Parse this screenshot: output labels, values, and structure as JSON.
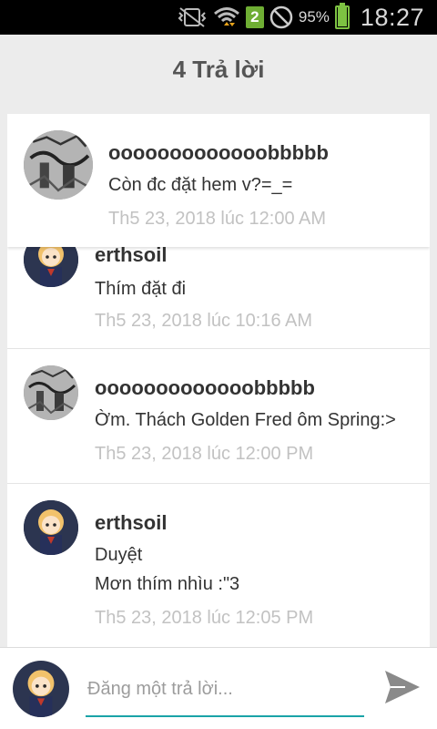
{
  "status_bar": {
    "sim_badge": "2",
    "battery_pct": "95%",
    "battery_level": 0.95,
    "time": "18:27",
    "icons": [
      "vibrate-off-icon",
      "wifi-icon",
      "sim-badge",
      "do-not-disturb-icon",
      "battery-icon"
    ]
  },
  "header": {
    "title": "4 Trả lời"
  },
  "original_post": {
    "author": "ooooooooooooobbbbb",
    "text": "Còn đc đặt hem v?=_=",
    "timestamp": "Th5 23, 2018 lúc 12:00 AM",
    "avatar": "sketch-avatar"
  },
  "replies": [
    {
      "author": "erthsoil",
      "text": "Thím đặt đi",
      "timestamp": "Th5 23, 2018 lúc 10:16 AM",
      "avatar": "anime-girl-avatar"
    },
    {
      "author": "ooooooooooooobbbbb",
      "text": "Ờm. Thách Golden Fred ôm Spring:>",
      "timestamp": "Th5 23, 2018 lúc 12:00 PM",
      "avatar": "sketch-avatar"
    },
    {
      "author": "erthsoil",
      "text_line1": "Duyệt",
      "text_line2": "Mơn thím nhìu :\"3",
      "timestamp": "Th5 23, 2018 lúc 12:05 PM",
      "avatar": "anime-girl-avatar"
    }
  ],
  "compose": {
    "placeholder": "Đăng một trả lời...",
    "value": "",
    "accent_color": "#1aa3a8",
    "send_icon": "send-icon"
  }
}
